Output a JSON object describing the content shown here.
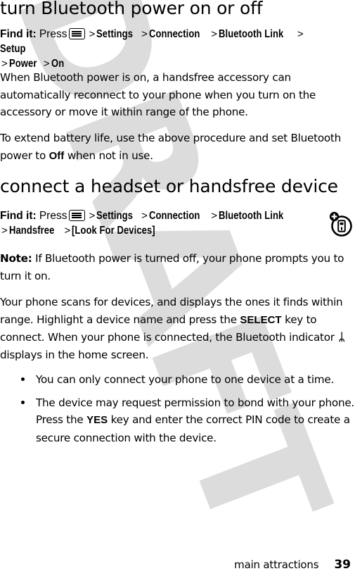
{
  "document": {
    "watermark_text": "DRAFT",
    "watermark_color": "#dcdcdc",
    "text_color": "#000000",
    "background_color": "#ffffff"
  },
  "sections": [
    {
      "heading": "turn Bluetooth power on or off",
      "findit": {
        "lead": "Find it:",
        "press": "Press",
        "key_icon": "menu-key-icon",
        "path": [
          "Settings",
          "Connection",
          "Bluetooth Link",
          "Setup",
          "Power",
          "On"
        ],
        "separator": ">"
      },
      "paragraphs": [
        "When Bluetooth power is on, a handsfree accessory can automatically reconnect to your phone when you turn on the accessory or move it within range of the phone.",
        "To extend battery life, use the above procedure and set Bluetooth power to Off when not in use."
      ]
    },
    {
      "heading": "connect a headset or handsfree device",
      "findit": {
        "lead": "Find it:",
        "press": "Press",
        "key_icon": "menu-key-icon",
        "path": [
          "Settings",
          "Connection",
          "Bluetooth Link",
          "Handsfree",
          "[Look For Devices]"
        ],
        "separator": ">"
      },
      "margin_icon": "phone-add-device-icon"
    }
  ],
  "para_1": {
    "line1": "When Bluetooth power is on, a handsfree accessory can",
    "line2": "automatically reconnect to your phone when you turn on the",
    "line3": "accessory or move it within range of the phone."
  },
  "para_2": {
    "before": "To extend battery life, use the above procedure and set Bluetooth power to ",
    "bold": "Off",
    "after": " when not in use."
  },
  "para_note": {
    "label": "Note:",
    "text": " If Bluetooth power is turned off, your phone prompts you to turn it on."
  },
  "para_scan": {
    "part1": "Your phone scans for devices, and displays the ones it finds within range. Highlight a device name and press the ",
    "key1": "SELECT",
    "part2": " key to connect. When your phone is connected, the Bluetooth indicator ",
    "bt_glyph": "ᛦ",
    "part3": " displays in the home screen."
  },
  "bullets": [
    {
      "text": "You can only connect your phone to one device at a time."
    },
    {
      "part1": "The device may request permission to bond with your phone. Press the ",
      "key": "YES",
      "part2": " key and enter the correct PIN code to create a secure connection with the device."
    }
  ],
  "footer": {
    "title": "main attractions",
    "page": "39"
  }
}
